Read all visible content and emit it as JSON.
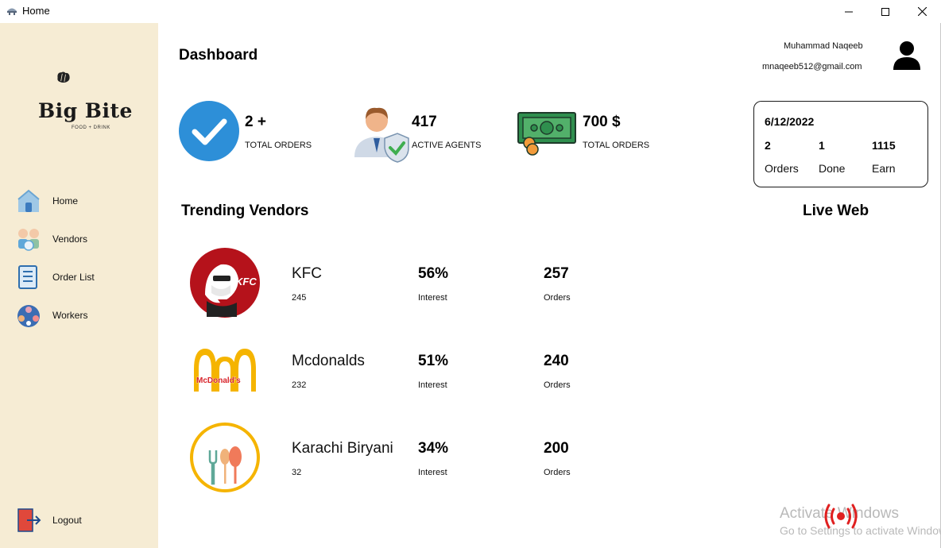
{
  "window": {
    "title": "Home"
  },
  "sidebar": {
    "logo_text": "Big Bite",
    "logo_sub": "FOOD + DRINK",
    "items": [
      {
        "label": "Home",
        "icon": "home-icon"
      },
      {
        "label": "Vendors",
        "icon": "vendors-icon"
      },
      {
        "label": "Order List",
        "icon": "order-list-icon"
      },
      {
        "label": "Workers",
        "icon": "workers-icon"
      }
    ],
    "logout_label": "Logout"
  },
  "header": {
    "title": "Dashboard",
    "user_name": "Muhammad Naqeeb",
    "user_email": "mnaqeeb512@gmail.com"
  },
  "stats": [
    {
      "value": "2 +",
      "label": "TOTAL ORDERS",
      "icon": "check-circle-icon"
    },
    {
      "value": "417",
      "label": "ACTIVE AGENTS",
      "icon": "agent-shield-icon"
    },
    {
      "value": "700 $",
      "label": "TOTAL ORDERS",
      "icon": "money-icon"
    }
  ],
  "summary": {
    "date": "6/12/2022",
    "values": [
      "2",
      "1",
      "1115"
    ],
    "labels": [
      "Orders",
      "Done",
      "Earn"
    ]
  },
  "trending": {
    "title": "Trending Vendors",
    "vendors": [
      {
        "name": "KFC",
        "count": "245",
        "interest": "56%",
        "interest_label": "Interest",
        "orders": "257",
        "orders_label": "Orders",
        "logo": "kfc-logo"
      },
      {
        "name": "Mcdonalds",
        "count": "232",
        "interest": "51%",
        "interest_label": "Interest",
        "orders": "240",
        "orders_label": "Orders",
        "logo": "mcdonalds-logo"
      },
      {
        "name": "Karachi Biryani",
        "count": "32",
        "interest": "34%",
        "interest_label": "Interest",
        "orders": "200",
        "orders_label": "Orders",
        "logo": "karachi-biryani-logo"
      }
    ]
  },
  "live_web": {
    "title": "Live Web"
  },
  "watermark": {
    "line1": "Activate Windows",
    "line2": "Go to Settings to activate Windows."
  },
  "colors": {
    "sidebar_bg": "#f6ecd4",
    "accent_blue": "#2d8fd8",
    "kfc_red": "#b5121b",
    "mcd_yellow": "#f5b400"
  }
}
